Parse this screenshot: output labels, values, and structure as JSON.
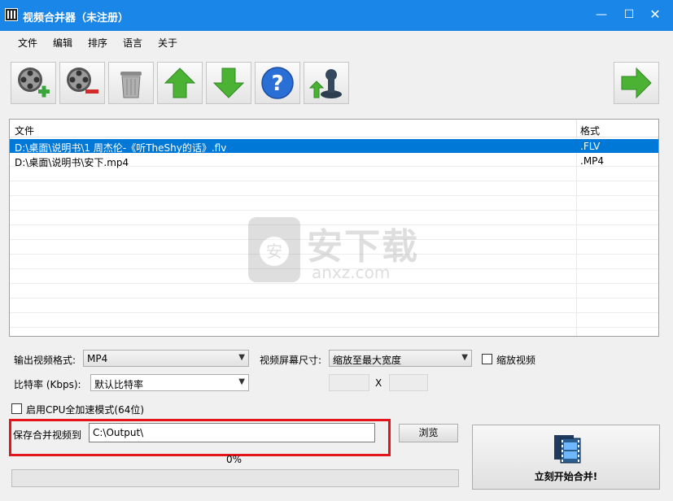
{
  "window": {
    "title": "视频合并器（未注册）",
    "minimize": "—",
    "maximize": "☐",
    "close": "✕"
  },
  "menu": [
    "文件",
    "编辑",
    "排序",
    "语言",
    "关于"
  ],
  "toolbar": [
    {
      "name": "add-video-button",
      "icon": "film-reel-plus-icon"
    },
    {
      "name": "remove-video-button",
      "icon": "film-reel-minus-icon"
    },
    {
      "name": "clear-list-button",
      "icon": "trash-can-icon"
    },
    {
      "name": "move-up-button",
      "icon": "arrow-up-icon"
    },
    {
      "name": "move-down-button",
      "icon": "arrow-down-icon"
    },
    {
      "name": "help-button",
      "icon": "question-mark-icon"
    },
    {
      "name": "register-button",
      "icon": "stamp-up-icon"
    },
    {
      "name": "next-button",
      "icon": "arrow-right-icon"
    }
  ],
  "file_list": {
    "columns": [
      "文件",
      "格式"
    ],
    "rows": [
      {
        "file": "D:\\桌面\\说明书\\1 周杰伦-《听TheShy的话》.flv",
        "format": ".FLV",
        "selected": true
      },
      {
        "file": "D:\\桌面\\说明书\\安下.mp4",
        "format": ".MP4",
        "selected": false
      }
    ]
  },
  "watermark": {
    "text": "安下载",
    "sub": "anxz.com"
  },
  "settings": {
    "output_format_label": "输出视频格式:",
    "output_format_value": "MP4",
    "screen_size_label": "视频屏幕尺寸:",
    "screen_size_value": "缩放至最大宽度",
    "scale_video_label": "缩放视频",
    "bitrate_label": "比特率 (Kbps):",
    "bitrate_value": "默认比特率",
    "size_separator": "X",
    "cpu_accel_label": "启用CPU全加速模式(64位)",
    "save_to_label": "保存合并视频到",
    "save_path": "C:\\Output\\",
    "browse_label": "浏览",
    "progress_text": "0%",
    "progress_value": 0,
    "start_label": "立刻开始合并!"
  },
  "colors": {
    "titlebar": "#1a86e8",
    "selection": "#0078d7",
    "highlight_box": "#e4141b",
    "arrow_green": "#4cb234"
  }
}
